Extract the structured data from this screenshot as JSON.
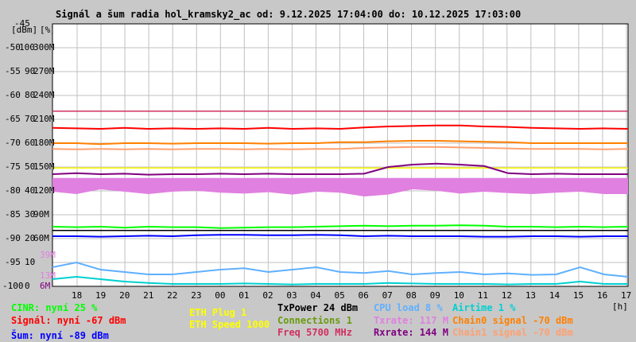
{
  "chart_data": {
    "type": "line",
    "title": "Signál a šum radia hol_kramsky2_ac od: 9.12.2025 17:04:00 do: 10.12.2025 17:03:00",
    "y_units": [
      "[dBm]",
      "[%]"
    ],
    "x_unit": "[h]",
    "ylim": [
      -100,
      -45
    ],
    "y_ticks": [
      {
        "dbm": "-45",
        "pct": "",
        "rate": ""
      },
      {
        "dbm": "-50",
        "pct": "100",
        "rate": "300M"
      },
      {
        "dbm": "-55",
        "pct": "90",
        "rate": "270M"
      },
      {
        "dbm": "-60",
        "pct": "80",
        "rate": "240M"
      },
      {
        "dbm": "-65",
        "pct": "70",
        "rate": "210M"
      },
      {
        "dbm": "-70",
        "pct": "60",
        "rate": "180M"
      },
      {
        "dbm": "-75",
        "pct": "50",
        "rate": "150M"
      },
      {
        "dbm": "-80",
        "pct": "40",
        "rate": "120M"
      },
      {
        "dbm": "-85",
        "pct": "30",
        "rate": "90M"
      },
      {
        "dbm": "-90",
        "pct": "20",
        "rate": "60M"
      },
      {
        "dbm": "-95",
        "pct": "10",
        "rate": ""
      },
      {
        "dbm": "-100",
        "pct": "0",
        "rate": "6M"
      }
    ],
    "extra_rate_ticks": [
      {
        "label": "39M",
        "value": -93.5,
        "color": "#e080e0"
      },
      {
        "label": "13M",
        "value": -97.8,
        "color": "#e080e0"
      }
    ],
    "x_ticks": [
      "18",
      "19",
      "20",
      "21",
      "22",
      "23",
      "00",
      "01",
      "02",
      "03",
      "04",
      "05",
      "06",
      "07",
      "08",
      "09",
      "10",
      "11",
      "12",
      "13",
      "14",
      "15",
      "16",
      "17"
    ],
    "ref_lines": [
      {
        "name": "freq",
        "value": -63.3,
        "color": "#d03060"
      },
      {
        "name": "eth-speed",
        "value": -75.2,
        "color": "#ffff00"
      },
      {
        "name": "txpower",
        "value": -88.3,
        "color": "#000000"
      }
    ],
    "series": [
      {
        "name": "Signál",
        "color": "#ff0000",
        "values": [
          -66.8,
          -66.9,
          -67,
          -66.8,
          -67,
          -66.9,
          -67,
          -66.9,
          -67,
          -66.8,
          -67,
          -66.9,
          -67,
          -66.7,
          -66.5,
          -66.4,
          -66.3,
          -66.3,
          -66.5,
          -66.6,
          -66.8,
          -66.9,
          -67,
          -66.9,
          -67
        ]
      },
      {
        "name": "Chain0 signal",
        "color": "#ff8000",
        "values": [
          -70,
          -70,
          -70.2,
          -70,
          -70,
          -70.1,
          -70,
          -70,
          -70,
          -70.1,
          -70,
          -70,
          -69.8,
          -69.8,
          -69.6,
          -69.5,
          -69.5,
          -69.6,
          -69.7,
          -69.8,
          -70,
          -70,
          -70,
          -70,
          -70
        ]
      },
      {
        "name": "Chain1 signal",
        "color": "#ffa070",
        "values": [
          -71.2,
          -71.3,
          -71.2,
          -71.3,
          -71.2,
          -71.3,
          -71.2,
          -71.2,
          -71.3,
          -71.2,
          -71.3,
          -71.2,
          -71.2,
          -71,
          -70.9,
          -70.8,
          -70.8,
          -70.9,
          -71,
          -71.1,
          -71.2,
          -71.2,
          -71.2,
          -71.3,
          -71.2
        ]
      },
      {
        "name": "Šum",
        "color": "#0000ff",
        "values": [
          -89.5,
          -89.5,
          -89.6,
          -89.5,
          -89.4,
          -89.5,
          -89.3,
          -89.2,
          -89.2,
          -89.3,
          -89.3,
          -89.2,
          -89.3,
          -89.5,
          -89.4,
          -89.5,
          -89.5,
          -89.5,
          -89.6,
          -89.6,
          -89.5,
          -89.5,
          -89.6,
          -89.5,
          -89.5
        ]
      },
      {
        "name": "CINR",
        "color": "#00ff00",
        "values": [
          -87.5,
          -87.6,
          -87.5,
          -87.7,
          -87.5,
          -87.6,
          -87.6,
          -87.8,
          -87.7,
          -87.6,
          -87.6,
          -87.5,
          -87.4,
          -87.3,
          -87.4,
          -87.3,
          -87.3,
          -87.2,
          -87.3,
          -87.5,
          -87.5,
          -87.6,
          -87.5,
          -87.6,
          -87.5
        ]
      },
      {
        "name": "Txrate",
        "color": "#e080e0",
        "values": [
          -80,
          -80.5,
          -79.5,
          -80,
          -80.5,
          -80,
          -79.8,
          -80.2,
          -80.4,
          -80.1,
          -80.6,
          -80,
          -80.2,
          -81,
          -80.6,
          -79.5,
          -79.8,
          -80.4,
          -80,
          -80.3,
          -80.5,
          -80.2,
          -80,
          -80.5,
          -80.5
        ]
      },
      {
        "name": "Rxrate",
        "color": "#800080",
        "values": [
          -76.5,
          -76.3,
          -76.5,
          -76.4,
          -76.6,
          -76.5,
          -76.5,
          -76.4,
          -76.5,
          -76.4,
          -76.5,
          -76.5,
          -76.5,
          -76.4,
          -75,
          -74.5,
          -74.3,
          -74.5,
          -74.8,
          -76.3,
          -76.5,
          -76.4,
          -76.5,
          -76.5,
          -76.5
        ]
      },
      {
        "name": "CPU load",
        "color": "#60b0ff",
        "values": [
          -96,
          -95,
          -96.5,
          -97,
          -97.5,
          -97.5,
          -97,
          -96.5,
          -96.2,
          -97,
          -96.5,
          -96,
          -97,
          -97.2,
          -96.8,
          -97.5,
          -97.2,
          -97,
          -97.5,
          -97.3,
          -97.6,
          -97.5,
          -96,
          -97.5,
          -98
        ]
      },
      {
        "name": "Airtime",
        "color": "#00d0d0",
        "values": [
          -98.5,
          -98,
          -98.5,
          -99,
          -99.3,
          -99.5,
          -99.5,
          -99.5,
          -99.4,
          -99.5,
          -99.6,
          -99.5,
          -99.5,
          -99.5,
          -99.3,
          -99.4,
          -99.5,
          -99.5,
          -99.5,
          -99.6,
          -99.5,
          -99.5,
          -99,
          -99.5,
          -99.5
        ]
      }
    ]
  },
  "legend": {
    "cinr": "CINR: nyní 25 %",
    "signal": "Signál: nyní -67 dBm",
    "noise": "Šum: nyní -89 dBm",
    "eth_plug": "ETH Plug 1",
    "eth_speed": "ETH Speed 1000",
    "txpower": "TxPower 24 dBm",
    "connections": "Connections 1",
    "freq": "Freq 5700 MHz",
    "cpu": "CPU load 8 %",
    "txrate": "Txrate: 117 M",
    "rxrate": "Rxrate: 144 M",
    "airtime": "Airtime 1 %",
    "chain0": "Chain0 signal -70 dBm",
    "chain1": "Chain1 signal -70 dBm"
  }
}
